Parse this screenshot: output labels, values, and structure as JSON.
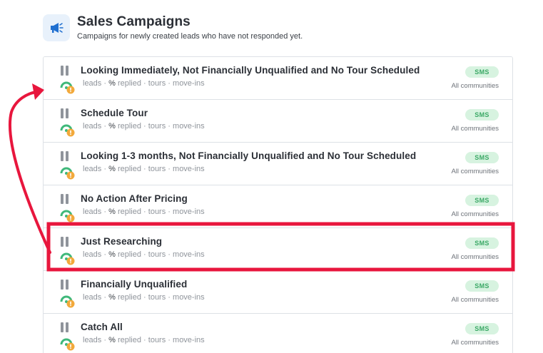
{
  "header": {
    "icon": "megaphone-icon",
    "title": "Sales Campaigns",
    "subtitle": "Campaigns for newly created leads who have not responded yet."
  },
  "stats_labels": {
    "leads": "leads",
    "dot": "·",
    "percent": "%",
    "replied": "replied",
    "tours": "tours",
    "move_ins": "move-ins"
  },
  "campaigns": [
    {
      "title": "Looking Immediately, Not Financially Unqualified and No Tour Scheduled",
      "channel": "SMS",
      "communities": "All communities"
    },
    {
      "title": "Schedule Tour",
      "channel": "SMS",
      "communities": "All communities"
    },
    {
      "title": "Looking 1-3 months, Not Financially Unqualified and No Tour Scheduled",
      "channel": "SMS",
      "communities": "All communities"
    },
    {
      "title": "No Action After Pricing",
      "channel": "SMS",
      "communities": "All communities"
    },
    {
      "title": "Just Researching",
      "channel": "SMS",
      "communities": "All communities"
    },
    {
      "title": "Financially Unqualified",
      "channel": "SMS",
      "communities": "All communities"
    },
    {
      "title": "Catch All",
      "channel": "SMS",
      "communities": "All communities"
    }
  ],
  "colors": {
    "annotation": "#e8163d",
    "badge_bg": "#d7f3e0",
    "badge_text": "#3aa865",
    "status_green": "#3fb87a",
    "status_orange": "#f2a93b"
  }
}
